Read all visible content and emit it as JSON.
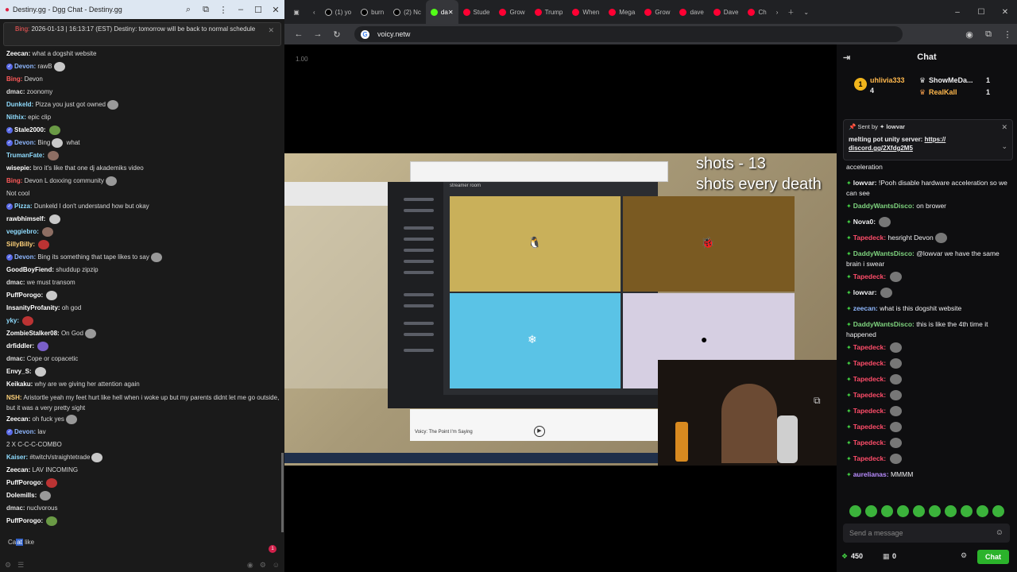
{
  "left_window": {
    "title": "Destiny.gg - Dgg Chat - Destiny.gg",
    "pinned": {
      "name": "Bing:",
      "text": "2026-01-13 | 16:13:17 (EST) Destiny: tomorrow will be back to normal schedule"
    },
    "messages": [
      {
        "name": "Zeecan:",
        "text": "what a dogshit website",
        "color": "#ffffff",
        "badge": false
      },
      {
        "name": "Devon:",
        "text": "rawB",
        "color": "#8fb8ff",
        "badge": true
      },
      {
        "name": "Bing:",
        "text": "Devon",
        "color": "#ff5a5a",
        "badge": false
      },
      {
        "name": "dmac:",
        "text": "zoonomy",
        "color": "#dddddd",
        "badge": false
      },
      {
        "name": "Dunkeld:",
        "text": "Pizza you just got owned",
        "color": "#8fdcff",
        "badge": false
      },
      {
        "name": "Nithix:",
        "text": "epic clip",
        "color": "#8fdcff",
        "badge": false
      },
      {
        "name": "Stale2000:",
        "text": "",
        "color": "#ffffff",
        "badge": true
      },
      {
        "name": "Devon:",
        "text": "Bing",
        "color": "#8fb8ff",
        "badge": true,
        "suffix": "what"
      },
      {
        "name": "TrumanFate:",
        "text": "",
        "color": "#8fdcff",
        "badge": false
      },
      {
        "name": "wisepie:",
        "text": "bro it's like that one dj akademiks video",
        "color": "#ffffff",
        "badge": false
      },
      {
        "name": "Bing:",
        "text": "Devon L doxxing community",
        "color": "#ff5a5a",
        "badge": false
      },
      {
        "name": "",
        "text": "Not cool",
        "color": "#dddddd",
        "badge": false
      },
      {
        "name": "Pizza:",
        "text": "Dunkeld I don't understand how but okay",
        "color": "#8fdcff",
        "badge": true
      },
      {
        "name": "rawbhimself:",
        "text": "",
        "color": "#ffffff",
        "badge": false
      },
      {
        "name": "veggiebro:",
        "text": "",
        "color": "#8fdcff",
        "badge": false
      },
      {
        "name": "SillyBilly:",
        "text": "",
        "color": "#ffd27a",
        "badge": false
      },
      {
        "name": "Devon:",
        "text": "Bing its something that tape likes to say",
        "color": "#8fb8ff",
        "badge": true
      },
      {
        "name": "GoodBoyFiend:",
        "text": "shuddup zipzip",
        "color": "#ffffff",
        "badge": false
      },
      {
        "name": "dmac:",
        "text": "we must transom",
        "color": "#dddddd",
        "badge": false
      },
      {
        "name": "PuffPorogo:",
        "text": "",
        "color": "#ffffff",
        "badge": false
      },
      {
        "name": "InsanityProfanity:",
        "text": "oh god",
        "color": "#ffffff",
        "badge": false
      },
      {
        "name": "yky:",
        "text": "",
        "color": "#8fdcff",
        "badge": false
      },
      {
        "name": "ZombieStalker08:",
        "text": "On God",
        "color": "#ffffff",
        "badge": false
      },
      {
        "name": "drfiddler:",
        "text": "",
        "color": "#ffffff",
        "badge": false
      },
      {
        "name": "dmac:",
        "text": "Cope or copacetic",
        "color": "#dddddd",
        "badge": false
      },
      {
        "name": "Envy_S:",
        "text": "",
        "color": "#ffffff",
        "badge": false
      },
      {
        "name": "Keikaku:",
        "text": "why are we giving her attention again",
        "color": "#ffffff",
        "badge": false
      },
      {
        "name": "NSH:",
        "text": "Aristortle yeah my feet hurt like hell when i woke up but my parents didnt let me go outside, but it was a very pretty sight",
        "color": "#ffd27a",
        "badge": false,
        "tall": true
      },
      {
        "name": "Zeecan:",
        "text": "oh fuck yes",
        "color": "#ffffff",
        "badge": false
      },
      {
        "name": "Devon:",
        "text": "lav",
        "color": "#8fb8ff",
        "badge": true
      },
      {
        "name": "",
        "text": "2 X C-C-C-COMBO",
        "color": "#dddddd",
        "badge": false
      },
      {
        "name": "Kaiser:",
        "text": "#twitch/straightetrade",
        "color": "#8fdcff",
        "badge": false
      },
      {
        "name": "Zeecan:",
        "text": "LAV INCOMING",
        "color": "#ffffff",
        "badge": false
      },
      {
        "name": "PuffPorogo:",
        "text": "",
        "color": "#ffffff",
        "badge": false
      },
      {
        "name": "Dolemills:",
        "text": "",
        "color": "#ffffff",
        "badge": false
      },
      {
        "name": "dmac:",
        "text": "nuclvorous",
        "color": "#dddddd",
        "badge": false
      },
      {
        "name": "PuffPorogo:",
        "text": "",
        "color": "#ffffff",
        "badge": false
      }
    ],
    "input": {
      "pre": "Ca",
      "sel": "at",
      "post": " like"
    },
    "notif_count": "1"
  },
  "browser": {
    "tabs": [
      {
        "label": "(1) yo",
        "icon": "x-icon"
      },
      {
        "label": "burn",
        "icon": "x-icon"
      },
      {
        "label": "(2) Nc",
        "icon": "x-icon"
      },
      {
        "label": "da",
        "icon": "kick-icon",
        "active": true
      },
      {
        "label": "Stude",
        "icon": "youtube-icon"
      },
      {
        "label": "Grow",
        "icon": "youtube-icon"
      },
      {
        "label": "Trump",
        "icon": "youtube-icon"
      },
      {
        "label": "When",
        "icon": "youtube-icon"
      },
      {
        "label": "Mega",
        "icon": "youtube-icon"
      },
      {
        "label": "Grow",
        "icon": "youtube-icon"
      },
      {
        "label": "dave",
        "icon": "youtube-icon"
      },
      {
        "label": "Dave",
        "icon": "youtube-icon"
      },
      {
        "label": "Ch",
        "icon": "youtube-icon"
      }
    ],
    "url": "voicy.netw"
  },
  "video": {
    "rate": "1.00",
    "overlay_line1": "shots - 13",
    "overlay_line2": "shots every death",
    "player_title": "Voicy: The Point I'm Saying",
    "discord_room": "streamer room"
  },
  "chat": {
    "title": "Chat",
    "leaderboard": [
      {
        "rank": "1",
        "name": "uhlivia333",
        "count": "4"
      },
      {
        "rank": "",
        "name": "ShowMeDa...",
        "count": "1"
      },
      {
        "rank": "",
        "name": "RealKall",
        "count": "1"
      }
    ],
    "pinned": {
      "header": "Sent by",
      "by": "lowvar",
      "body": "melting pot unity server: ",
      "link": "https:// discord.gg/2Xfdg2M5"
    },
    "messages": [
      {
        "name": "",
        "text": "acceleration",
        "color": "#efeff1"
      },
      {
        "name": "lowvar:",
        "text": "!Pooh disable hardware acceleration so we can see",
        "color": "#efeff1",
        "emo": false
      },
      {
        "name": "DaddyWantsDisco:",
        "text": "on brower",
        "color": "#7fd47f"
      },
      {
        "name": "Nova0:",
        "text": "",
        "color": "#efeff1",
        "emo": true
      },
      {
        "name": "Tapedeck:",
        "text": "hesright Devon",
        "color": "#ff4d6a",
        "emo": true
      },
      {
        "name": "DaddyWantsDisco:",
        "text": "@lowvar we have the same brain i swear",
        "color": "#7fd47f"
      },
      {
        "name": "Tapedeck:",
        "text": "",
        "color": "#ff4d6a",
        "emo": true
      },
      {
        "name": "lowvar:",
        "text": "",
        "color": "#efeff1",
        "emo": true
      },
      {
        "name": "zeecan:",
        "text": "what is this dogshit website",
        "color": "#8fb8ff"
      },
      {
        "name": "DaddyWantsDisco:",
        "text": "this is like the 4th time it happened",
        "color": "#7fd47f"
      },
      {
        "name": "Tapedeck:",
        "text": "",
        "color": "#ff4d6a",
        "emo": true
      },
      {
        "name": "Tapedeck:",
        "text": "",
        "color": "#ff4d6a",
        "emo": true
      },
      {
        "name": "Tapedeck:",
        "text": "",
        "color": "#ff4d6a",
        "emo": true
      },
      {
        "name": "Tapedeck:",
        "text": "",
        "color": "#ff4d6a",
        "emo": true
      },
      {
        "name": "Tapedeck:",
        "text": "",
        "color": "#ff4d6a",
        "emo": true
      },
      {
        "name": "Tapedeck:",
        "text": "",
        "color": "#ff4d6a",
        "emo": true
      },
      {
        "name": "Tapedeck:",
        "text": "",
        "color": "#ff4d6a",
        "emo": true
      },
      {
        "name": "Tapedeck:",
        "text": "",
        "color": "#ff4d6a",
        "emo": true
      },
      {
        "name": "aurelianas:",
        "text": "MMMM",
        "color": "#b98cff"
      }
    ],
    "send_placeholder": "Send a message",
    "points": "450",
    "count": "0",
    "chat_button": "Chat"
  }
}
